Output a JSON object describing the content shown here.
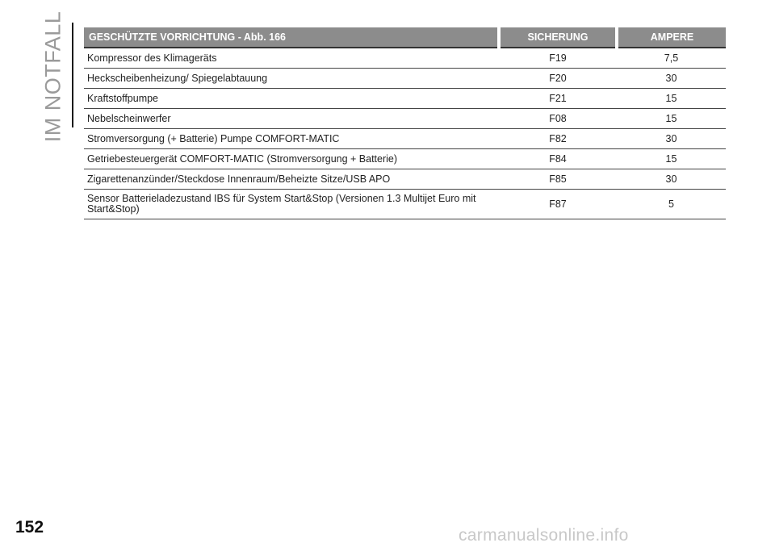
{
  "side_title": "IM NOTFALL",
  "table": {
    "headers": {
      "device": "GESCHÜTZTE VORRICHTUNG - Abb. 166",
      "fuse": "SICHERUNG",
      "ampere": "AMPERE"
    },
    "rows": [
      {
        "device": "Kompressor des Klimageräts",
        "fuse": "F19",
        "ampere": "7,5"
      },
      {
        "device": "Heckscheibenheizung/ Spiegelabtauung",
        "fuse": "F20",
        "ampere": "30"
      },
      {
        "device": "Kraftstoffpumpe",
        "fuse": "F21",
        "ampere": "15"
      },
      {
        "device": "Nebelscheinwerfer",
        "fuse": "F08",
        "ampere": "15"
      },
      {
        "device": "Stromversorgung (+ Batterie) Pumpe COMFORT-MATIC",
        "fuse": "F82",
        "ampere": "30"
      },
      {
        "device": "Getriebesteuergerät COMFORT-MATIC (Stromversorgung + Batterie)",
        "fuse": "F84",
        "ampere": "15"
      },
      {
        "device": "Zigarettenanzünder/Steckdose Innenraum/Beheizte Sitze/USB APO",
        "fuse": "F85",
        "ampere": "30"
      },
      {
        "device": "Sensor Batterieladezustand IBS für System Start&Stop (Versionen 1.3 Multijet Euro mit Start&Stop)",
        "fuse": "F87",
        "ampere": "5"
      }
    ]
  },
  "page_number": "152",
  "watermark": "carmanualsonline.info"
}
